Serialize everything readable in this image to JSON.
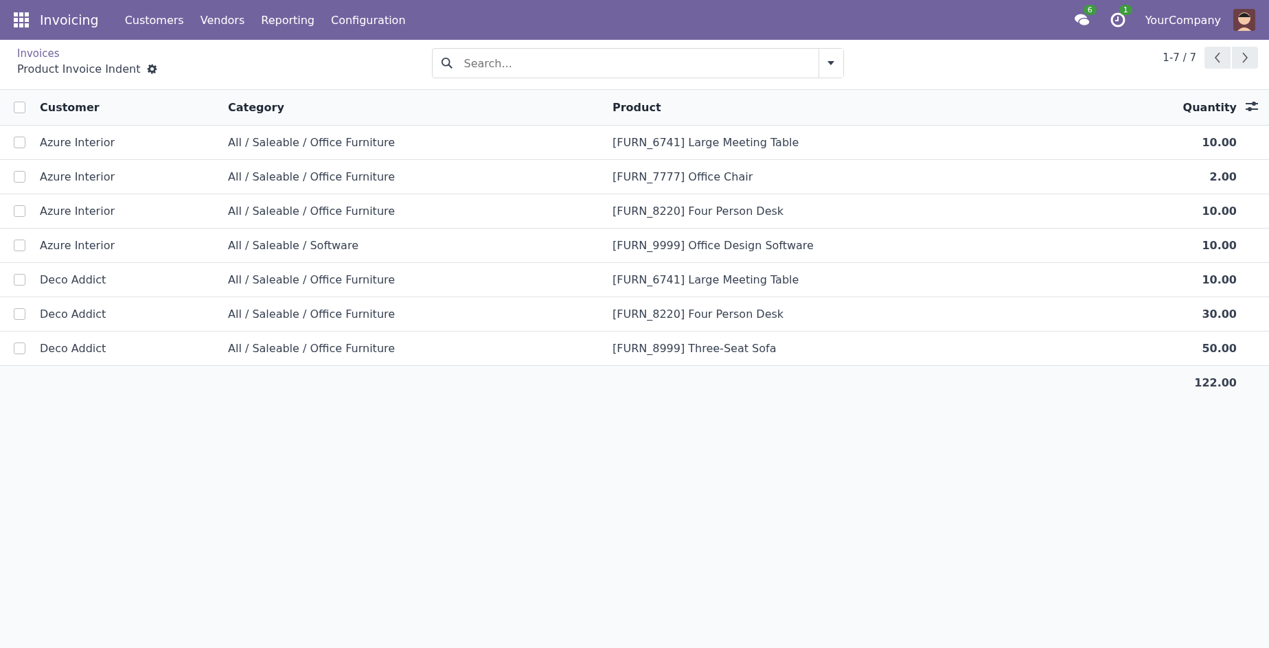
{
  "navbar": {
    "app_name": "Invoicing",
    "menu": [
      "Customers",
      "Vendors",
      "Reporting",
      "Configuration"
    ],
    "messages_count": "6",
    "activities_count": "1",
    "company": "YourCompany"
  },
  "control_panel": {
    "breadcrumb": "Invoices",
    "title": "Product Invoice Indent",
    "search": {
      "placeholder": "Search..."
    },
    "pager": "1-7 / 7"
  },
  "table": {
    "all_selected": false,
    "columns": [
      "Customer",
      "Category",
      "Product",
      "Quantity"
    ],
    "rows": [
      {
        "customer": "Azure Interior",
        "category": "All / Saleable / Office Furniture",
        "product": "[FURN_6741] Large Meeting Table",
        "quantity": "10.00",
        "selected": false
      },
      {
        "customer": "Azure Interior",
        "category": "All / Saleable / Office Furniture",
        "product": "[FURN_7777] Office Chair",
        "quantity": "2.00",
        "selected": false
      },
      {
        "customer": "Azure Interior",
        "category": "All / Saleable / Office Furniture",
        "product": "[FURN_8220] Four Person Desk",
        "quantity": "10.00",
        "selected": false
      },
      {
        "customer": "Azure Interior",
        "category": "All / Saleable / Software",
        "product": "[FURN_9999] Office Design Software",
        "quantity": "10.00",
        "selected": false
      },
      {
        "customer": "Deco Addict",
        "category": "All / Saleable / Office Furniture",
        "product": "[FURN_6741] Large Meeting Table",
        "quantity": "10.00",
        "selected": false
      },
      {
        "customer": "Deco Addict",
        "category": "All / Saleable / Office Furniture",
        "product": "[FURN_8220] Four Person Desk",
        "quantity": "30.00",
        "selected": false
      },
      {
        "customer": "Deco Addict",
        "category": "All / Saleable / Office Furniture",
        "product": "[FURN_8999] Three-Seat Sofa",
        "quantity": "50.00",
        "selected": false
      }
    ],
    "total_quantity": "122.00"
  }
}
